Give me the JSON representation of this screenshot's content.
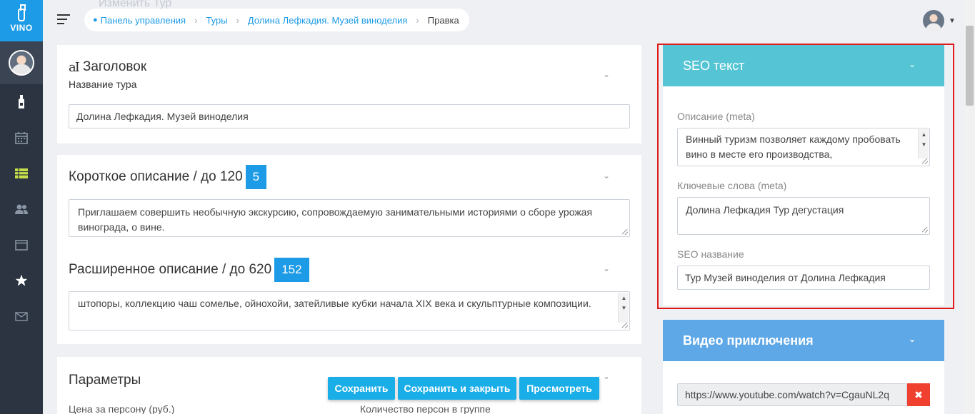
{
  "app": {
    "logo_text": "VINO"
  },
  "header": {
    "ghost_title": "Изменить Тур"
  },
  "breadcrumb": {
    "items": [
      "Панель управления",
      "Туры",
      "Долина Лефкадия. Музей виноделия"
    ],
    "current": "Правка"
  },
  "sidebar": {
    "icons": [
      "wine-bottle-icon",
      "calendar-icon",
      "table-list-icon",
      "users-icon",
      "window-icon",
      "star-icon",
      "mail-icon"
    ],
    "active_index": 2
  },
  "title_section": {
    "heading": "Заголовок",
    "heading_glyph": "aI",
    "label": "Название тура",
    "value": "Долина Лефкадия. Музей виноделия"
  },
  "short_desc": {
    "heading": "Короткое описание / до 120",
    "counter": "5",
    "value": "Приглашаем совершить необычную экскурсию, сопровождаемую занимательными историями о сборе урожая винограда, о вине."
  },
  "long_desc": {
    "heading": "Расширенное описание / до 620",
    "counter": "152",
    "value": "штопоры, коллекцию чаш сомелье, ойнохойи, затейливые кубки начала XIX века и скульптурные композиции."
  },
  "params": {
    "heading": "Параметры",
    "price_label": "Цена за персону (руб.)",
    "group_label": "Количество персон в группе"
  },
  "actions": {
    "save": "Сохранить",
    "save_close": "Сохранить и закрыть",
    "preview": "Просмотреть"
  },
  "seo": {
    "title": "SEO текст",
    "desc_label": "Описание (meta)",
    "desc_value": "Винный туризм позволяет каждому пробовать вино в месте его производства,",
    "keywords_label": "Ключевые слова (meta)",
    "keywords_value": "Долина Лефкадия Тур дегустация",
    "name_label": "SEO название",
    "name_value": "Тур Музей виноделия от Долина Лефкадия"
  },
  "video": {
    "title": "Видео приключения",
    "url": "https://www.youtube.com/watch?v=CgauNL2q"
  },
  "colors": {
    "accent": "#1e9be6",
    "seo_header": "#55c4d4",
    "video_header": "#5fa8e8",
    "sidebar": "#2b3440",
    "highlight_frame": "#e01b1b",
    "delete": "#f04030"
  }
}
